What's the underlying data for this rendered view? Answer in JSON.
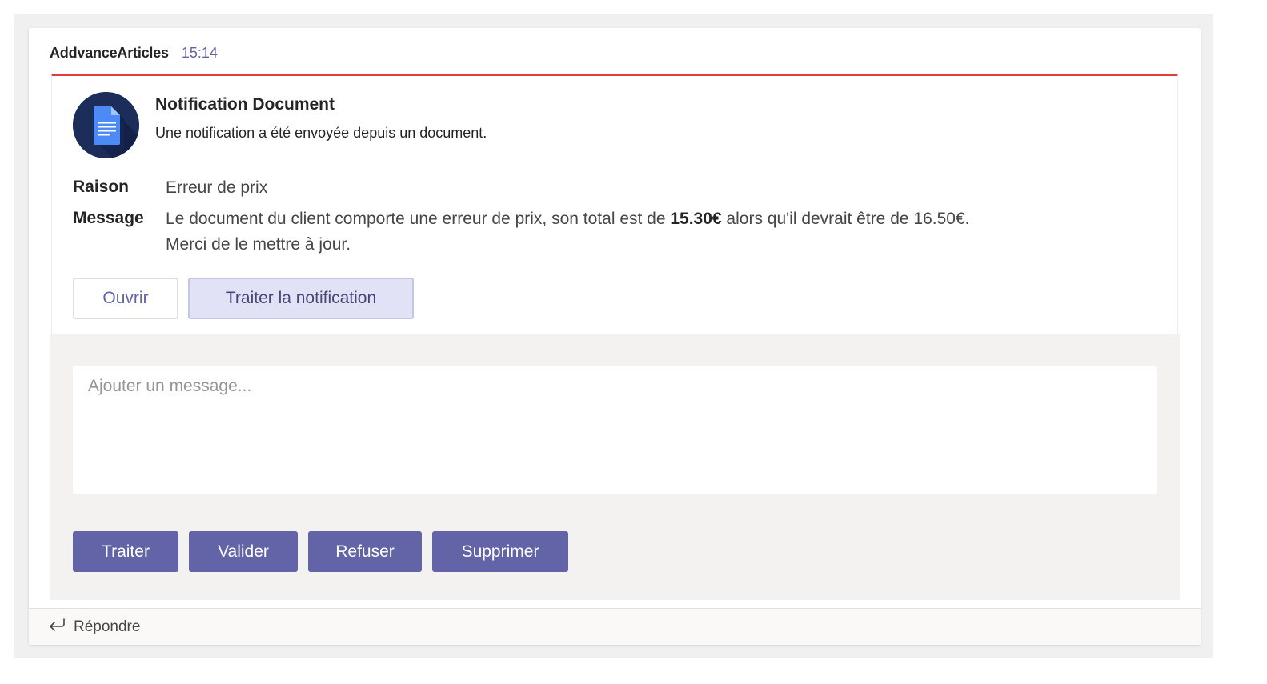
{
  "message": {
    "sender": "AddvanceArticles",
    "time": "15:14"
  },
  "card": {
    "accent_color": "#e03c3a",
    "icon": "google-docs-icon",
    "title": "Notification Document",
    "subtitle": "Une notification a été envoyée depuis un document.",
    "facts": {
      "reason_label": "Raison",
      "reason_value": "Erreur de prix",
      "message_label": "Message",
      "message_part1": "Le document du client comporte une erreur de prix, son total est de ",
      "message_bold": "15.30€",
      "message_part2": " alors qu'il devrait être de 16.50€.",
      "message_line2": "Merci de le mettre à jour."
    },
    "actions": {
      "open_label": "Ouvrir",
      "process_notification_label": "Traiter la notification"
    }
  },
  "show_card": {
    "input_placeholder": "Ajouter un message...",
    "input_value": "",
    "buttons": {
      "process": "Traiter",
      "validate": "Valider",
      "reject": "Refuser",
      "delete": "Supprimer"
    },
    "button_color": "#6264a7"
  },
  "reply": {
    "icon": "reply-arrow-icon",
    "label": "Répondre"
  }
}
